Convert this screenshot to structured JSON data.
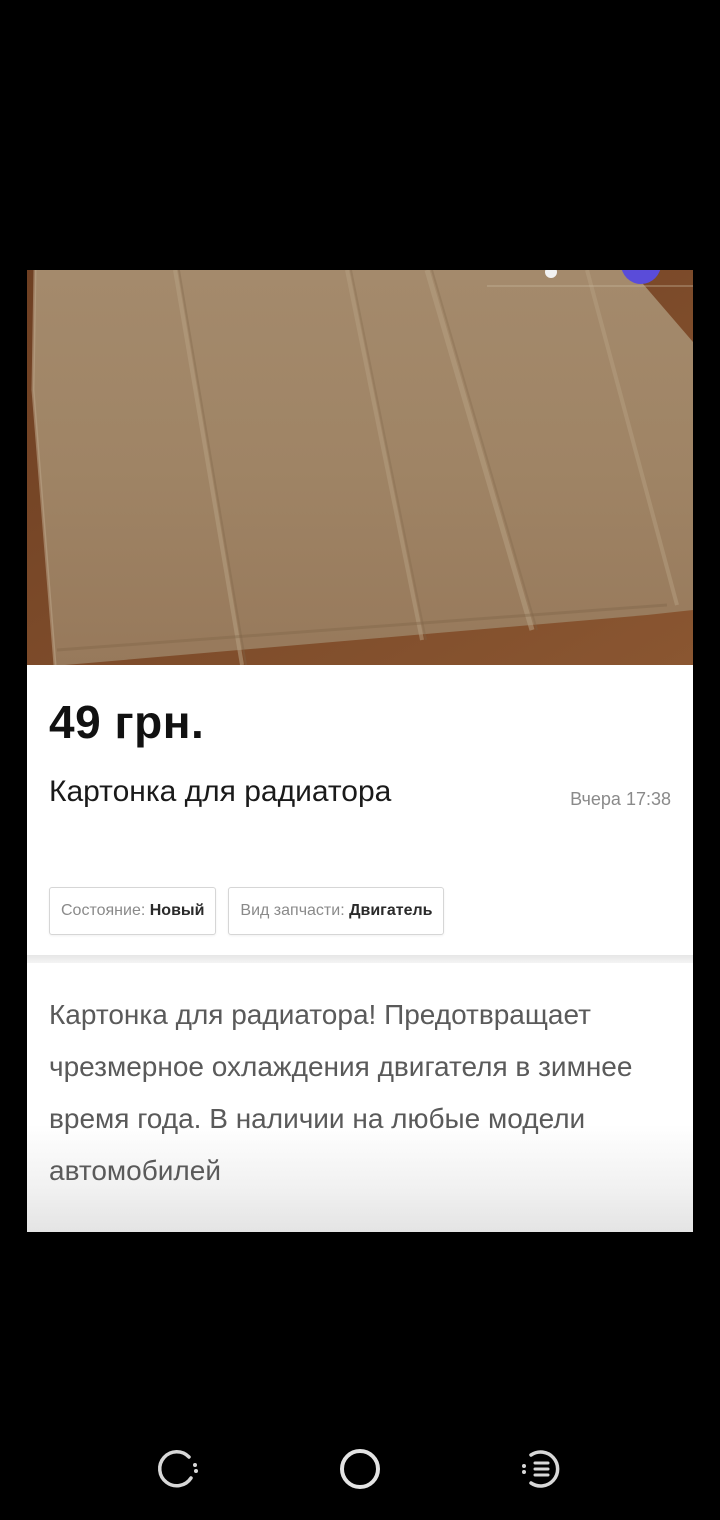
{
  "listing": {
    "price": "49 грн.",
    "title": "Картонка для радиатора",
    "date": "Вчера 17:38",
    "tags": [
      {
        "label": "Состояние:",
        "value": "Новый"
      },
      {
        "label": "Вид запчасти:",
        "value": "Двигатель"
      }
    ],
    "description": "Картонка для радиатора! Предотвращает чрезмерное охлаждения двигателя в зимнее время года. В наличии на любые модели автомобилей"
  },
  "photo": {
    "subject": "cardboard-sheet",
    "colors": {
      "cardboard": "#a08668",
      "background": "#7a4a2a"
    }
  },
  "navbar": {
    "buttons": [
      "recent-apps-icon",
      "home-icon",
      "back-icon"
    ]
  }
}
